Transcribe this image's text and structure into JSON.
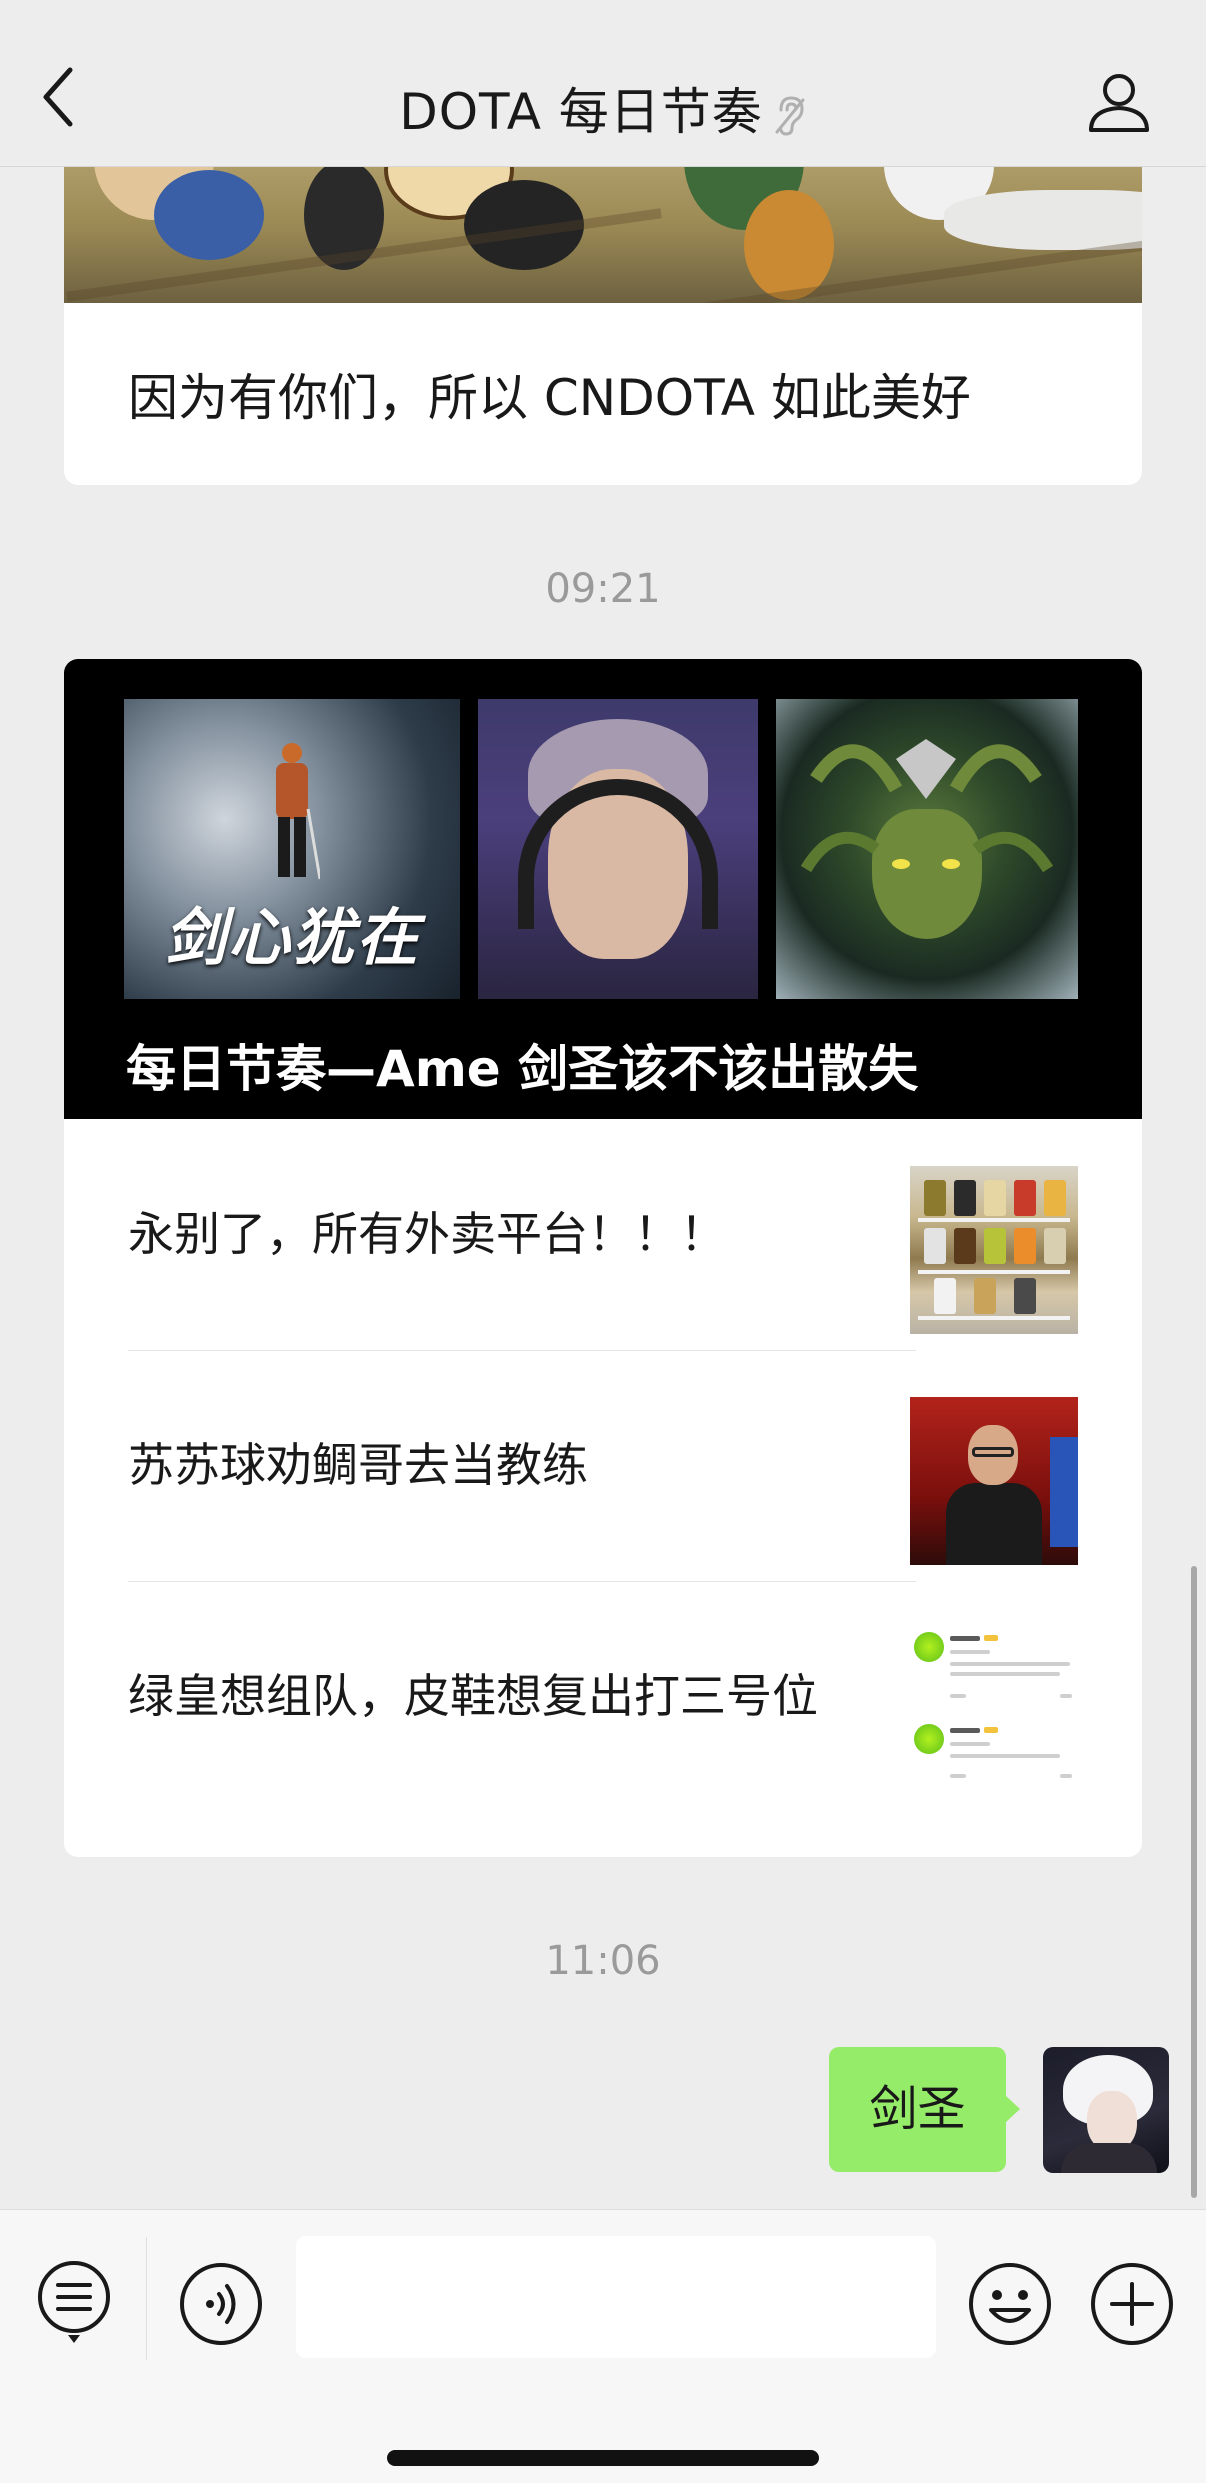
{
  "header": {
    "title": "DOTA 每日节奏",
    "back_icon": "chevron-left-icon",
    "mute_icon": "ear-off-icon",
    "profile_icon": "person-icon"
  },
  "messages": [
    {
      "type": "article-card",
      "title": "因为有你们，所以 CNDOTA 如此美好"
    },
    {
      "type": "timestamp",
      "time": "09:21"
    },
    {
      "type": "article-list",
      "hero_title": "每日节奏—Ame 剑圣该不该出散失",
      "hero_image_caption": "剑心犹在",
      "items": [
        {
          "title": "永别了，所有外卖平台！！！"
        },
        {
          "title": "苏苏球劝鲷哥去当教练"
        },
        {
          "title": "绿皇想组队，皮鞋想复出打三号位"
        }
      ]
    },
    {
      "type": "timestamp",
      "time": "11:06"
    },
    {
      "type": "sent-text",
      "text": "剑圣"
    }
  ],
  "input_bar": {
    "menu_icon": "menu-list-icon",
    "voice_icon": "voice-icon",
    "input_value": "",
    "emoji_icon": "emoji-icon",
    "plus_icon": "plus-icon"
  },
  "colors": {
    "background": "#ededed",
    "bubble_green": "#95ec69",
    "card_white": "#ffffff",
    "hero_bg": "#000000",
    "timestamp_gray": "#9a9a9a"
  }
}
